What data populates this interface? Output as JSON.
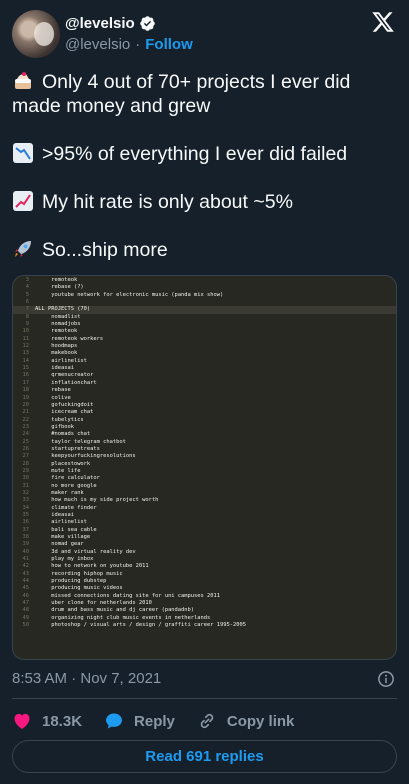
{
  "author": {
    "display_name": "@levelsio",
    "handle": "@levelsio",
    "separator": "·",
    "follow_label": "Follow"
  },
  "tweet": {
    "lines": [
      {
        "emoji": "cake-icon",
        "text": "Only 4 out of 70+ projects I ever did made money and grew"
      },
      {
        "emoji": "chart-decreasing-icon",
        "text": ">95% of everything I ever did failed"
      },
      {
        "emoji": "chart-increasing-icon",
        "text": "My hit rate is only about ~5%"
      },
      {
        "emoji": "rocket-icon",
        "text": "So...ship more"
      }
    ]
  },
  "code_screenshot": {
    "current_line": "7",
    "lines": [
      {
        "n": "3",
        "t": "     remoteok"
      },
      {
        "n": "4",
        "t": "     rebase (?)"
      },
      {
        "n": "5",
        "t": "     youtube network for electronic music (panda mix show)"
      },
      {
        "n": "6",
        "t": ""
      },
      {
        "n": "7",
        "t": "ALL PROJECTS (70)"
      },
      {
        "n": "8",
        "t": "     nomadlist"
      },
      {
        "n": "9",
        "t": "     nomadjobs"
      },
      {
        "n": "10",
        "t": "     remoteok"
      },
      {
        "n": "11",
        "t": "     remoteok workers"
      },
      {
        "n": "12",
        "t": "     hoodmaps"
      },
      {
        "n": "13",
        "t": "     makebook"
      },
      {
        "n": "14",
        "t": "     airlinelist"
      },
      {
        "n": "15",
        "t": "     ideasai"
      },
      {
        "n": "16",
        "t": "     qrmenucreator"
      },
      {
        "n": "17",
        "t": "     inflationchart"
      },
      {
        "n": "18",
        "t": "     rebase"
      },
      {
        "n": "19",
        "t": "     colive"
      },
      {
        "n": "20",
        "t": "     gofuckingdoit"
      },
      {
        "n": "21",
        "t": "     icecream chat"
      },
      {
        "n": "22",
        "t": "     tubelytics"
      },
      {
        "n": "23",
        "t": "     gifbook"
      },
      {
        "n": "24",
        "t": "     #nomads chat"
      },
      {
        "n": "25",
        "t": "     taylor telegram chatbot"
      },
      {
        "n": "26",
        "t": "     startupretreats"
      },
      {
        "n": "27",
        "t": "     keepyourfuckingresolutions"
      },
      {
        "n": "28",
        "t": "     placestowork"
      },
      {
        "n": "29",
        "t": "     mute life"
      },
      {
        "n": "30",
        "t": "     fire calculator"
      },
      {
        "n": "31",
        "t": "     no more google"
      },
      {
        "n": "32",
        "t": "     maker rank"
      },
      {
        "n": "33",
        "t": "     how much is my side project worth"
      },
      {
        "n": "34",
        "t": "     climate finder"
      },
      {
        "n": "35",
        "t": "     ideasai"
      },
      {
        "n": "36",
        "t": "     airlinelist"
      },
      {
        "n": "37",
        "t": "     bali sea cable"
      },
      {
        "n": "38",
        "t": "     make village"
      },
      {
        "n": "39",
        "t": "     nomad gear"
      },
      {
        "n": "40",
        "t": "     3d and virtual reality dev"
      },
      {
        "n": "41",
        "t": "     play my inbox"
      },
      {
        "n": "42",
        "t": "     how to network on youtube 2011"
      },
      {
        "n": "43",
        "t": "     recording hiphop music"
      },
      {
        "n": "44",
        "t": "     producing dubstep"
      },
      {
        "n": "45",
        "t": "     producing music videos"
      },
      {
        "n": "46",
        "t": "     missed connections dating site for uni campuses 2011"
      },
      {
        "n": "47",
        "t": "     uber clone for netherlands 2010"
      },
      {
        "n": "48",
        "t": "     drum and bass music and dj career (pandadnb)"
      },
      {
        "n": "49",
        "t": "     organizing night club music events in netherlands"
      },
      {
        "n": "50",
        "t": "     photoshop / visual arts / design / graffiti career 1995-2005"
      }
    ]
  },
  "meta": {
    "timestamp": "8:53 AM · Nov 7, 2021"
  },
  "actions": {
    "like_count": "18.3K",
    "reply_label": "Reply",
    "copy_link_label": "Copy link"
  },
  "footer": {
    "read_replies_label": "Read 691 replies"
  },
  "colors": {
    "background": "#15202b",
    "accent": "#1d9bf0",
    "like": "#f91880",
    "muted": "#8b98a5",
    "border": "#38444d"
  }
}
